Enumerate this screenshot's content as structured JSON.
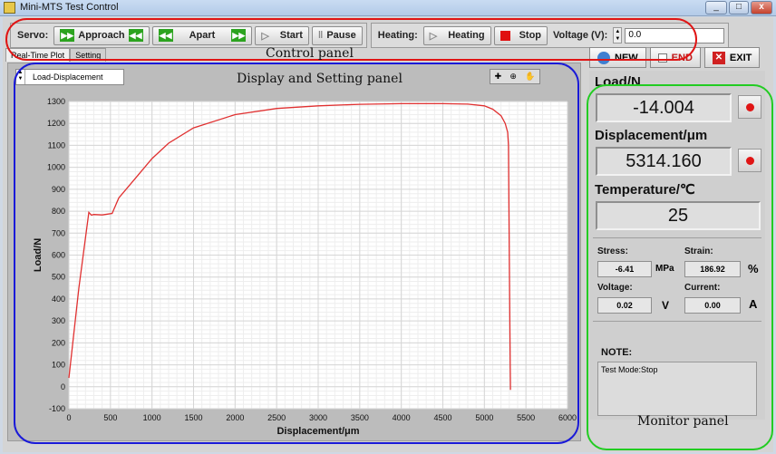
{
  "window": {
    "title": "Mini-MTS Test Control",
    "min": "_",
    "max": "□",
    "close": "x"
  },
  "toolbar": {
    "servo_label": "Servo:",
    "approach": "Approach",
    "apart": "Apart",
    "start": "Start",
    "pause": "Pause",
    "heating_label": "Heating:",
    "heating": "Heating",
    "stop": "Stop",
    "voltage_label": "Voltage (V):",
    "voltage_value": "0.0"
  },
  "tabs": [
    "Real-Time Plot",
    "Setting"
  ],
  "plot": {
    "selector": "Load-Displacement"
  },
  "annotations": {
    "control": "Control panel",
    "display": "Display and Setting panel",
    "monitor": "Monitor panel"
  },
  "right": {
    "new": "NEW",
    "end": "END",
    "exit": "EXIT",
    "load_label": "Load/N",
    "load_value": "-14.004",
    "disp_label": "Displacement/μm",
    "disp_value": "5314.160",
    "temp_label": "Temperature/℃",
    "temp_value": "25",
    "stress_label": "Stress:",
    "stress_value": "-6.41",
    "stress_unit": "MPa",
    "strain_label": "Strain:",
    "strain_value": "186.92",
    "strain_unit": "%",
    "voltage_label": "Voltage:",
    "voltage_value": "0.02",
    "voltage_unit": "V",
    "current_label": "Current:",
    "current_value": "0.00",
    "current_unit": "A",
    "note_label": "NOTE:",
    "note_text": "Test Mode:Stop"
  },
  "colors": {
    "curve": "#e03030",
    "control_ring": "#e01515",
    "display_ring": "#1a1ad8",
    "monitor_ring": "#22cc22"
  },
  "chart_data": {
    "type": "line",
    "xlabel": "Displacement/μm",
    "ylabel": "Load/N",
    "xlim": [
      0,
      6000
    ],
    "ylim": [
      -100,
      1300
    ],
    "xticks": [
      0,
      500,
      1000,
      1500,
      2000,
      2500,
      3000,
      3500,
      4000,
      4500,
      5000,
      5500,
      6000
    ],
    "yticks": [
      -100,
      0,
      100,
      200,
      300,
      400,
      500,
      600,
      700,
      800,
      900,
      1000,
      1100,
      1200,
      1300
    ],
    "grid": true,
    "series": [
      {
        "x": [
          0,
          120,
          240,
          270,
          300,
          400,
          520,
          600,
          800,
          1000,
          1200,
          1500,
          2000,
          2500,
          3000,
          3500,
          4000,
          4500,
          4800,
          5000,
          5100,
          5200,
          5250,
          5280,
          5290,
          5300,
          5310,
          5314
        ],
        "y": [
          40,
          450,
          795,
          782,
          785,
          783,
          790,
          860,
          950,
          1040,
          1110,
          1180,
          1240,
          1268,
          1280,
          1287,
          1290,
          1290,
          1288,
          1280,
          1265,
          1235,
          1200,
          1160,
          1100,
          600,
          100,
          -14
        ]
      }
    ]
  }
}
